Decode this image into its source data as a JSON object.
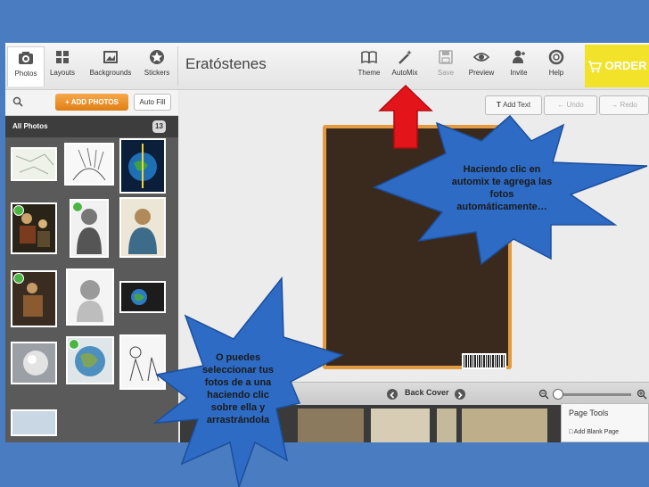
{
  "toolbar": {
    "left_tabs": [
      {
        "label": "Photos",
        "icon": "camera-icon"
      },
      {
        "label": "Layouts",
        "icon": "grid-icon"
      },
      {
        "label": "Backgrounds",
        "icon": "picture-icon"
      },
      {
        "label": "Stickers",
        "icon": "star-icon"
      }
    ],
    "document_title": "Eratóstenes",
    "right_buttons": [
      {
        "label": "Theme",
        "icon": "book-icon"
      },
      {
        "label": "AutoMix",
        "icon": "magic-wand-icon"
      },
      {
        "label": "Save",
        "icon": "floppy-icon"
      },
      {
        "label": "Preview",
        "icon": "eye-icon"
      },
      {
        "label": "Invite",
        "icon": "add-user-icon"
      },
      {
        "label": "Help",
        "icon": "lifebuoy-icon"
      }
    ],
    "order_label": "ORDER"
  },
  "left_panel": {
    "add_photos_label": "+ ADD PHOTOS",
    "auto_fill_label": "Auto Fill",
    "all_photos_label": "All Photos",
    "photo_count": "13"
  },
  "canvas_tools": {
    "add_text_label": "Add Text",
    "undo_label": "Undo",
    "redo_label": "Redo"
  },
  "navigation": {
    "page_label": "Back Cover"
  },
  "page_tools": {
    "title": "Page Tools",
    "item": "Add Blank Page"
  },
  "callouts": {
    "automix": "Haciendo clic en automix te agrega las fotos automáticamente…",
    "drag": "O puedes seleccionar tus fotos de a una haciendo clic sobre ella y arrastrándola"
  },
  "colors": {
    "slide_bg": "#4a7cc1",
    "order_yellow": "#f2e22a",
    "star_blue": "#2e6bc4",
    "arrow_red": "#e3151a",
    "cover_border": "#e49a40"
  }
}
